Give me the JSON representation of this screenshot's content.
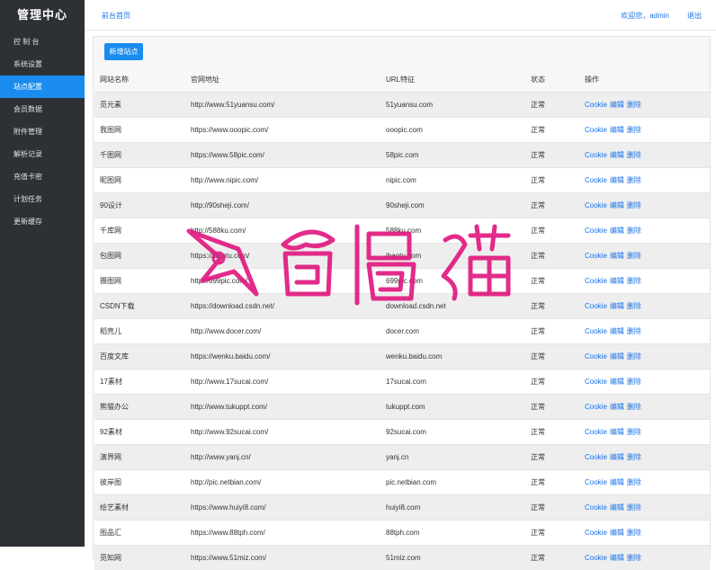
{
  "sidebar": {
    "brand": "管理中心",
    "items": [
      {
        "label": "控 制 台"
      },
      {
        "label": "系统设置"
      },
      {
        "label": "站点配置"
      },
      {
        "label": "会员数据"
      },
      {
        "label": "附件管理"
      },
      {
        "label": "解析记录"
      },
      {
        "label": "充值卡密"
      },
      {
        "label": "计划任务"
      },
      {
        "label": "更新缓存"
      }
    ],
    "active_index": 2
  },
  "topbar": {
    "home_link": "前台首页",
    "welcome": "欢迎您，admin",
    "logout": "退出"
  },
  "toolbar": {
    "add_label": "新增站点"
  },
  "table": {
    "headers": [
      "网站名称",
      "官网地址",
      "URL特征",
      "状态",
      "操作"
    ],
    "actions": [
      "Cookie",
      "编辑",
      "删除"
    ],
    "rows": [
      {
        "name": "觅元素",
        "url": "http://www.51yuansu.com/",
        "feature": "51yuansu.com",
        "status": "正常"
      },
      {
        "name": "我图网",
        "url": "https://www.ooopic.com/",
        "feature": "ooopic.com",
        "status": "正常"
      },
      {
        "name": "千图网",
        "url": "https://www.58pic.com/",
        "feature": "58pic.com",
        "status": "正常"
      },
      {
        "name": "昵图网",
        "url": "http://www.nipic.com/",
        "feature": "nipic.com",
        "status": "正常"
      },
      {
        "name": "90设计",
        "url": "http://90sheji.com/",
        "feature": "90sheji.com",
        "status": "正常"
      },
      {
        "name": "千库网",
        "url": "http://588ku.com/",
        "feature": "588ku.com",
        "status": "正常"
      },
      {
        "name": "包图网",
        "url": "https://ibaotu.com/",
        "feature": "ibaotu.com",
        "status": "正常"
      },
      {
        "name": "摄图网",
        "url": "http://699pic.com/",
        "feature": "699pic.com",
        "status": "正常"
      },
      {
        "name": "CSDN下载",
        "url": "https://download.csdn.net/",
        "feature": "download.csdn.net",
        "status": "正常"
      },
      {
        "name": "稻壳儿",
        "url": "http://www.docer.com/",
        "feature": "docer.com",
        "status": "正常"
      },
      {
        "name": "百度文库",
        "url": "https://wenku.baidu.com/",
        "feature": "wenku.baidu.com",
        "status": "正常"
      },
      {
        "name": "17素材",
        "url": "http://www.17sucai.com/",
        "feature": "17sucai.com",
        "status": "正常"
      },
      {
        "name": "熊猫办公",
        "url": "http://www.tukuppt.com/",
        "feature": "tukuppt.com",
        "status": "正常"
      },
      {
        "name": "92素材",
        "url": "http://www.92sucai.com/",
        "feature": "92sucai.com",
        "status": "正常"
      },
      {
        "name": "演界网",
        "url": "http://www.yanj.cn/",
        "feature": "yanj.cn",
        "status": "正常"
      },
      {
        "name": "彼岸图",
        "url": "http://pic.netbian.com/",
        "feature": "pic.netbian.com",
        "status": "正常"
      },
      {
        "name": "绘艺素材",
        "url": "https://www.huiyi8.com/",
        "feature": "huiyi8.com",
        "status": "正常"
      },
      {
        "name": "图品汇",
        "url": "https://www.88tph.com/",
        "feature": "88tph.com",
        "status": "正常"
      },
      {
        "name": "觅知网",
        "url": "https://www.51miz.com/",
        "feature": "51miz.com",
        "status": "正常"
      }
    ]
  },
  "watermark": {
    "text": "奇偶猫",
    "color": "#e0157e"
  },
  "colors": {
    "accent": "#1a8cf0",
    "sidebar_bg": "#2d3035",
    "link": "#1a73e8"
  }
}
